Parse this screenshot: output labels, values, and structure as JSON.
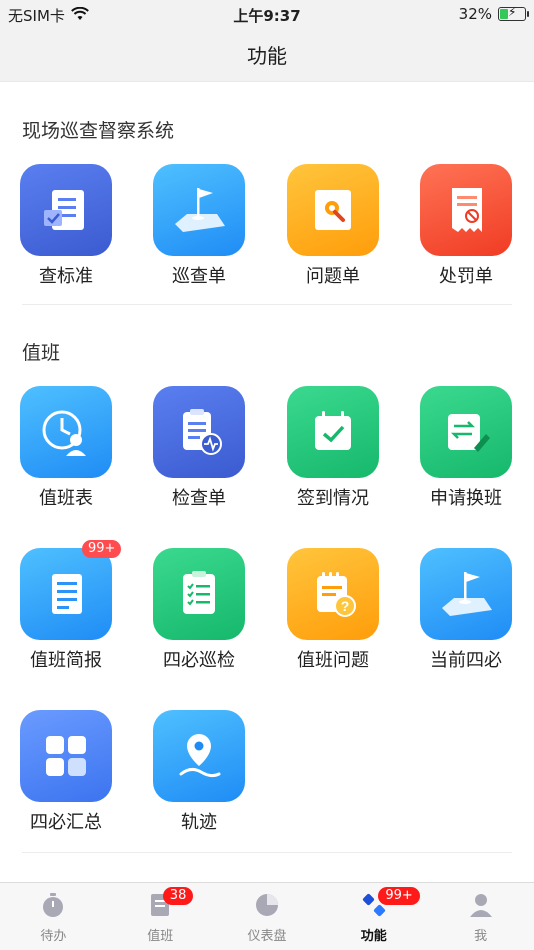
{
  "status_bar": {
    "carrier": "无SIM卡",
    "time": "上午9:37",
    "battery": "32%",
    "battery_level": 0.32
  },
  "nav": {
    "title": "功能"
  },
  "sections": [
    {
      "title": "现场巡查督察系统",
      "items": [
        {
          "label": "查标准",
          "icon": "standard-doc-icon"
        },
        {
          "label": "巡查单",
          "icon": "patrol-flag-icon"
        },
        {
          "label": "问题单",
          "icon": "problem-wrench-icon"
        },
        {
          "label": "处罚单",
          "icon": "penalty-receipt-icon"
        }
      ]
    },
    {
      "title": "值班",
      "items": [
        {
          "label": "值班表",
          "icon": "duty-clock-icon"
        },
        {
          "label": "检查单",
          "icon": "checklist-pulse-icon"
        },
        {
          "label": "签到情况",
          "icon": "calendar-check-icon"
        },
        {
          "label": "申请换班",
          "icon": "swap-edit-icon"
        },
        {
          "label": "值班简报",
          "icon": "brief-doc-icon",
          "badge": "99+"
        },
        {
          "label": "四必巡检",
          "icon": "inspect-list-icon"
        },
        {
          "label": "值班问题",
          "icon": "duty-question-icon"
        },
        {
          "label": "当前四必",
          "icon": "current-flag-icon"
        },
        {
          "label": "四必汇总",
          "icon": "grid-summary-icon"
        },
        {
          "label": "轨迹",
          "icon": "track-pin-icon"
        }
      ]
    }
  ],
  "tabs": [
    {
      "label": "待办",
      "icon": "stopwatch-icon"
    },
    {
      "label": "值班",
      "icon": "doc-icon",
      "badge": "38"
    },
    {
      "label": "仪表盘",
      "icon": "pie-icon"
    },
    {
      "label": "功能",
      "icon": "function-icon",
      "badge": "99+",
      "active": true
    },
    {
      "label": "我",
      "icon": "person-icon"
    }
  ],
  "colors": {
    "blue_deep": "#4a6cde",
    "blue_sky": "#33a6ff",
    "orange": "#ffb21f",
    "red": "#ff5a3c",
    "green": "#23c97d",
    "badge_red": "#ff4d4f"
  }
}
